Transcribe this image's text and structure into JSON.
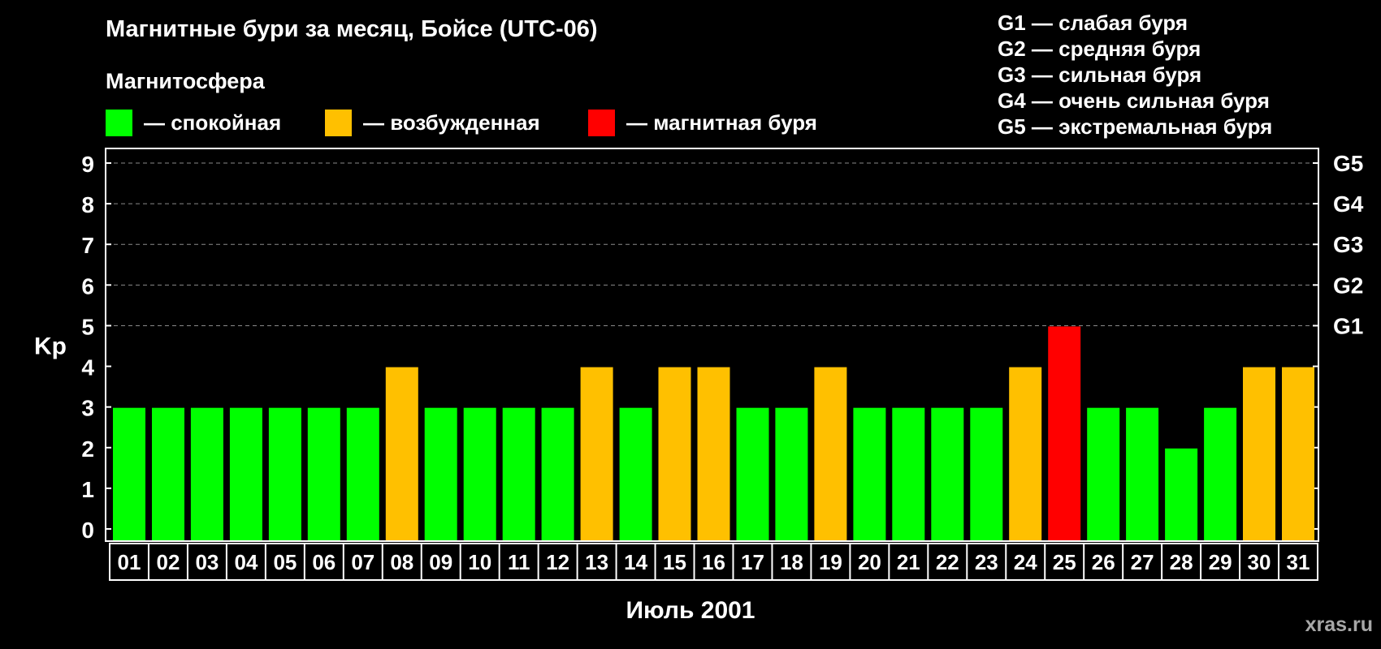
{
  "chart_data": {
    "type": "bar",
    "title": "Магнитные бури за месяц, Бойсе (UTC-06)",
    "legend_heading": "Магнитосфера",
    "legend": [
      {
        "label": "— спокойная",
        "color": "#00ff00"
      },
      {
        "label": "— возбужденная",
        "color": "#ffc000"
      },
      {
        "label": "— магнитная буря",
        "color": "#ff0000"
      }
    ],
    "storm_scale": [
      "G1 — слабая буря",
      "G2 — средняя буря",
      "G3 — сильная буря",
      "G4 — очень сильная буря",
      "G5 — экстремальная буря"
    ],
    "ylabel": "Kp",
    "xlabel": "Июль 2001",
    "ylim": [
      0,
      9
    ],
    "yticks": [
      "0",
      "1",
      "2",
      "3",
      "4",
      "5",
      "6",
      "7",
      "8",
      "9"
    ],
    "right_ticks": [
      {
        "y": 5,
        "label": "G1"
      },
      {
        "y": 6,
        "label": "G2"
      },
      {
        "y": 7,
        "label": "G3"
      },
      {
        "y": 8,
        "label": "G4"
      },
      {
        "y": 9,
        "label": "G5"
      }
    ],
    "grid": "dashed lines at Kp 5–9",
    "categories": [
      "01",
      "02",
      "03",
      "04",
      "05",
      "06",
      "07",
      "08",
      "09",
      "10",
      "11",
      "12",
      "13",
      "14",
      "15",
      "16",
      "17",
      "18",
      "19",
      "20",
      "21",
      "22",
      "23",
      "24",
      "25",
      "26",
      "27",
      "28",
      "29",
      "30",
      "31"
    ],
    "values": [
      3,
      3,
      3,
      3,
      3,
      3,
      3,
      4,
      3,
      3,
      3,
      3,
      4,
      3,
      4,
      4,
      3,
      3,
      4,
      3,
      3,
      3,
      3,
      4,
      5,
      3,
      3,
      2,
      3,
      4,
      4
    ],
    "colors": {
      "quiet": "#00ff00",
      "unsettled": "#ffc000",
      "storm": "#ff0000"
    }
  },
  "watermark": "xras.ru"
}
